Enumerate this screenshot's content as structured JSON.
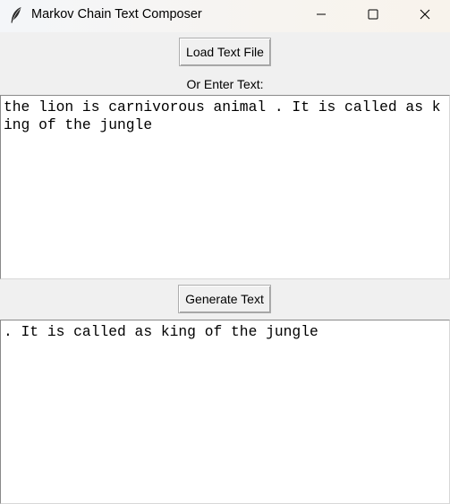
{
  "window": {
    "title": "Markov Chain Text Composer",
    "app_icon": "feather-icon",
    "controls": [
      "minimize-icon",
      "maximize-icon",
      "close-icon"
    ]
  },
  "toolbar": {
    "load_label": "Load Text File",
    "enter_label": "Or Enter Text:",
    "generate_label": "Generate Text"
  },
  "input": {
    "value": "the lion is carnivorous animal . It is called as king of the jungle"
  },
  "output": {
    "value": ". It is called as king of the jungle"
  }
}
